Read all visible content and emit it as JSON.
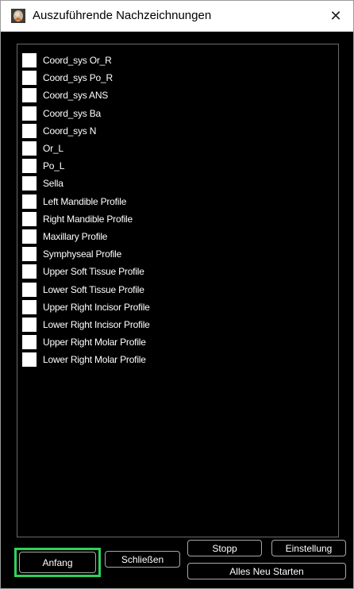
{
  "window": {
    "title": "Auszuführende Nachzeichnungen",
    "close_symbol": "✕"
  },
  "icons": {
    "app_icon": "cephalometric-app-icon",
    "close_icon": "close-icon"
  },
  "list": {
    "items": [
      {
        "label": "Coord_sys Or_R",
        "checked": false
      },
      {
        "label": "Coord_sys Po_R",
        "checked": false
      },
      {
        "label": "Coord_sys ANS",
        "checked": false
      },
      {
        "label": "Coord_sys Ba",
        "checked": false
      },
      {
        "label": "Coord_sys N",
        "checked": false
      },
      {
        "label": "Or_L",
        "checked": false
      },
      {
        "label": "Po_L",
        "checked": false
      },
      {
        "label": "Sella",
        "checked": false
      },
      {
        "label": "Left Mandible Profile",
        "checked": false
      },
      {
        "label": "Right Mandible Profile",
        "checked": false
      },
      {
        "label": "Maxillary Profile",
        "checked": false
      },
      {
        "label": "Symphyseal Profile",
        "checked": false
      },
      {
        "label": "Upper Soft Tissue Profile",
        "checked": false
      },
      {
        "label": "Lower Soft Tissue Profile",
        "checked": false
      },
      {
        "label": "Upper Right Incisor Profile",
        "checked": false
      },
      {
        "label": "Lower Right Incisor Profile",
        "checked": false
      },
      {
        "label": "Upper Right Molar Profile",
        "checked": false
      },
      {
        "label": "Lower Right Molar Profile",
        "checked": false
      }
    ]
  },
  "buttons": {
    "start": "Anfang",
    "close": "Schließen",
    "stop": "Stopp",
    "settings": "Einstellung",
    "restart_all": "Alles Neu Starten"
  },
  "colors": {
    "background": "#000000",
    "text": "#ffffff",
    "focus_outline": "#2fd15a",
    "checkbox": "#ffffff"
  }
}
